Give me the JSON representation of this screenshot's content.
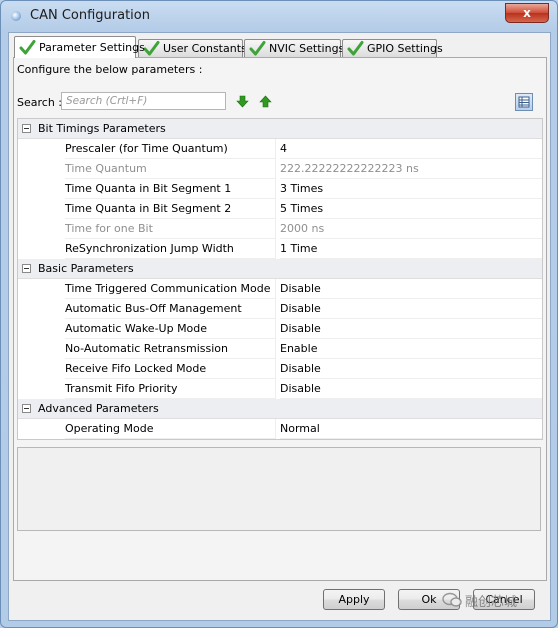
{
  "window": {
    "title": "CAN Configuration",
    "close_label": "x"
  },
  "tabs": [
    {
      "label": "Parameter Settings",
      "active": true
    },
    {
      "label": "User Constants",
      "active": false
    },
    {
      "label": "NVIC Settings",
      "active": false
    },
    {
      "label": "GPIO Settings",
      "active": false
    }
  ],
  "panel": {
    "configure_text": "Configure the below parameters :",
    "search_label": "Search :",
    "search_placeholder": "Search (Crtl+F)"
  },
  "groups": [
    {
      "label": "Bit Timings Parameters",
      "params": [
        {
          "name": "Prescaler (for Time Quantum)",
          "value": "4",
          "enabled": true
        },
        {
          "name": "Time Quantum",
          "value": "222.22222222222223 ns",
          "enabled": false
        },
        {
          "name": "Time Quanta in Bit Segment 1",
          "value": "3 Times",
          "enabled": true
        },
        {
          "name": "Time Quanta in Bit Segment 2",
          "value": "5 Times",
          "enabled": true
        },
        {
          "name": "Time for one Bit",
          "value": "2000 ns",
          "enabled": false
        },
        {
          "name": "ReSynchronization Jump Width",
          "value": "1 Time",
          "enabled": true
        }
      ]
    },
    {
      "label": "Basic Parameters",
      "params": [
        {
          "name": "Time Triggered Communication Mode",
          "value": "Disable",
          "enabled": true
        },
        {
          "name": "Automatic Bus-Off Management",
          "value": "Disable",
          "enabled": true
        },
        {
          "name": "Automatic Wake-Up Mode",
          "value": "Disable",
          "enabled": true
        },
        {
          "name": "No-Automatic Retransmission",
          "value": "Enable",
          "enabled": true
        },
        {
          "name": "Receive Fifo Locked Mode",
          "value": "Disable",
          "enabled": true
        },
        {
          "name": "Transmit Fifo Priority",
          "value": "Disable",
          "enabled": true
        }
      ]
    },
    {
      "label": "Advanced Parameters",
      "params": [
        {
          "name": "Operating Mode",
          "value": "Normal",
          "enabled": true
        }
      ]
    }
  ],
  "buttons": {
    "apply": "Apply",
    "ok": "Ok",
    "cancel": "Cancel"
  },
  "watermark": {
    "text": "融创芯城"
  },
  "colors": {
    "check_green": "#3fa33a",
    "arrow_green": "#2f9a1f",
    "close_red": "#c9432d"
  }
}
